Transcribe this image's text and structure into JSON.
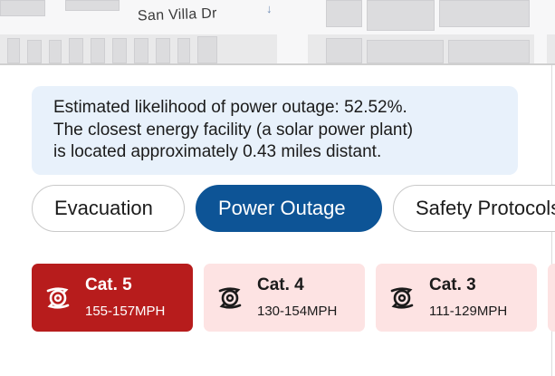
{
  "map": {
    "street_label": "San Villa Dr",
    "icons": [
      "direction-arrow-icon"
    ]
  },
  "info": {
    "lines": [
      "Estimated likelihood of power outage: 52.52%.",
      "The closest energy facility (a solar power plant)",
      "is located approximately 0.43 miles distant."
    ]
  },
  "tabs": [
    {
      "label": "Evacuation",
      "active": false
    },
    {
      "label": "Power Outage",
      "active": true
    },
    {
      "label": "Safety Protocols",
      "active": false
    }
  ],
  "categories": [
    {
      "title": "Cat. 5",
      "speed": "155-157MPH",
      "active": true,
      "icon": "hurricane-icon"
    },
    {
      "title": "Cat. 4",
      "speed": "130-154MPH",
      "active": false,
      "icon": "hurricane-icon"
    },
    {
      "title": "Cat. 3",
      "speed": "111-129MPH",
      "active": false,
      "icon": "hurricane-icon"
    }
  ],
  "colors": {
    "active_tab": "#0d5496",
    "active_card": "#b71c1c",
    "inactive_card": "#fde3e3",
    "info_bg": "#e8f1fb"
  }
}
